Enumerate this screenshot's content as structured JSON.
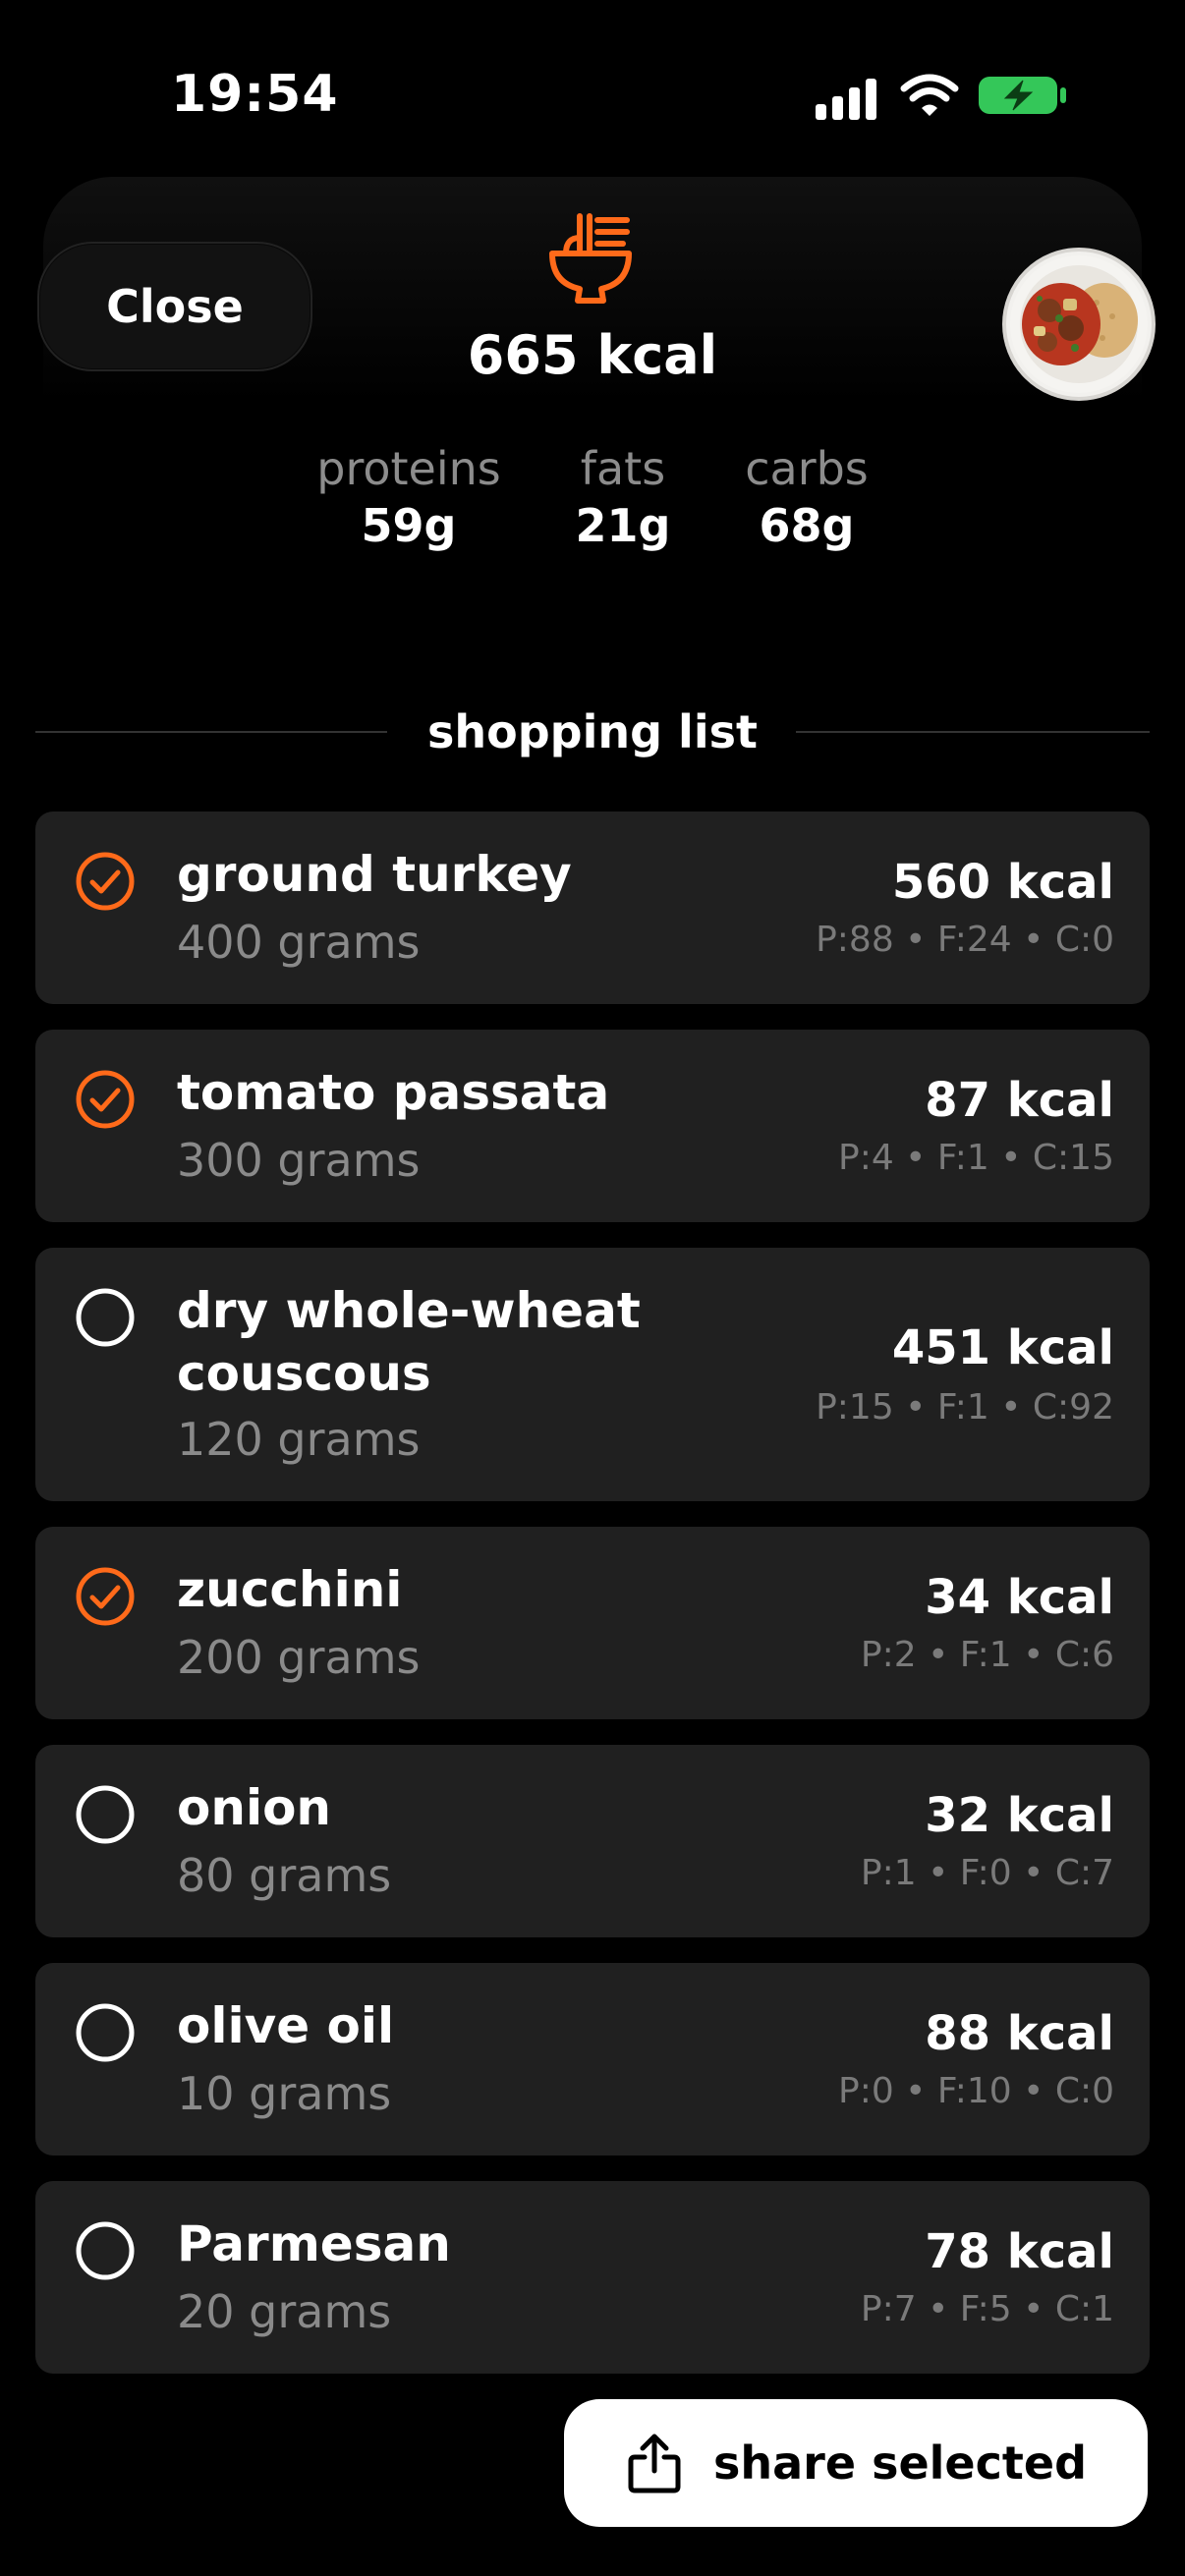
{
  "status_bar": {
    "time": "19:54"
  },
  "header": {
    "close_label": "Close",
    "kcal_total": "665 kcal",
    "macros": [
      {
        "label": "proteins",
        "value": "59g"
      },
      {
        "label": "fats",
        "value": "21g"
      },
      {
        "label": "carbs",
        "value": "68g"
      }
    ]
  },
  "section_title": "shopping list",
  "accent_color": "#FF6A1A",
  "items": [
    {
      "name": "ground turkey",
      "qty": "400 grams",
      "kcal": "560 kcal",
      "macros": "P:88 • F:24 • C:0",
      "checked": true
    },
    {
      "name": "tomato passata",
      "qty": "300 grams",
      "kcal": "87 kcal",
      "macros": "P:4 • F:1 • C:15",
      "checked": true
    },
    {
      "name": "dry whole-wheat couscous",
      "qty": "120 grams",
      "kcal": "451 kcal",
      "macros": "P:15 • F:1 • C:92",
      "checked": false
    },
    {
      "name": "zucchini",
      "qty": "200 grams",
      "kcal": "34 kcal",
      "macros": "P:2 • F:1 • C:6",
      "checked": true
    },
    {
      "name": "onion",
      "qty": "80 grams",
      "kcal": "32 kcal",
      "macros": "P:1 • F:0 • C:7",
      "checked": false
    },
    {
      "name": "olive oil",
      "qty": "10 grams",
      "kcal": "88 kcal",
      "macros": "P:0 • F:10 • C:0",
      "checked": false
    },
    {
      "name": "Parmesan",
      "qty": "20 grams",
      "kcal": "78 kcal",
      "macros": "P:7 • F:5 • C:1",
      "checked": false
    }
  ],
  "share_label": "share selected"
}
